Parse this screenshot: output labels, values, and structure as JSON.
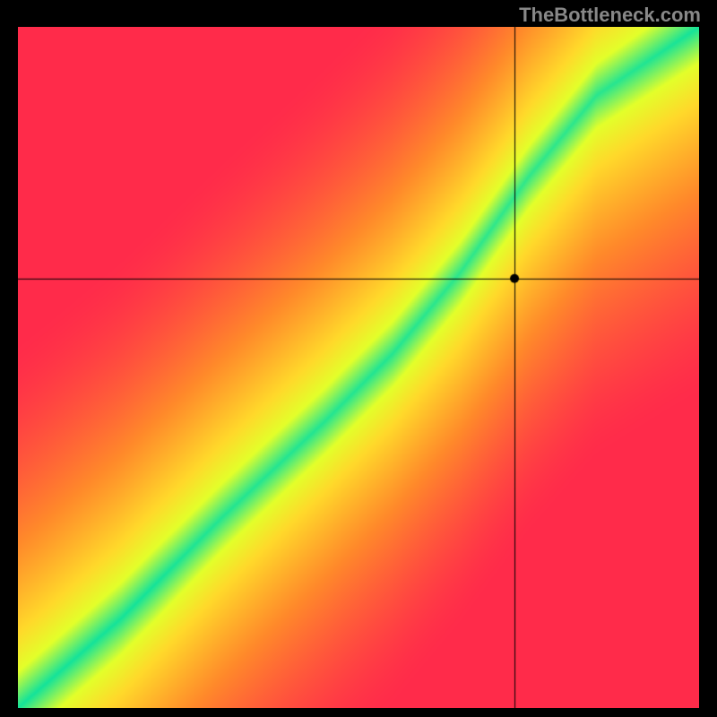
{
  "watermark": "TheBottleneck.com",
  "chart_data": {
    "type": "heatmap",
    "title": "",
    "xlabel": "",
    "ylabel": "",
    "xlim": [
      0,
      100
    ],
    "ylim": [
      0,
      100
    ],
    "crosshair": {
      "x": 73,
      "y": 63
    },
    "marker": {
      "x": 73,
      "y": 63
    },
    "gradient_stops": [
      {
        "value": 0.0,
        "color": "#ff2b4a"
      },
      {
        "value": 0.4,
        "color": "#ff8a2a"
      },
      {
        "value": 0.7,
        "color": "#ffd92a"
      },
      {
        "value": 0.85,
        "color": "#e3ff2a"
      },
      {
        "value": 1.0,
        "color": "#14e39a"
      }
    ],
    "ridge": {
      "description": "optimal match curve from bottom-left to top-right",
      "points": [
        {
          "x": 0,
          "y": 0
        },
        {
          "x": 15,
          "y": 13
        },
        {
          "x": 30,
          "y": 28
        },
        {
          "x": 45,
          "y": 42
        },
        {
          "x": 55,
          "y": 52
        },
        {
          "x": 65,
          "y": 64
        },
        {
          "x": 75,
          "y": 78
        },
        {
          "x": 85,
          "y": 90
        },
        {
          "x": 100,
          "y": 100
        }
      ],
      "width": 8
    }
  }
}
